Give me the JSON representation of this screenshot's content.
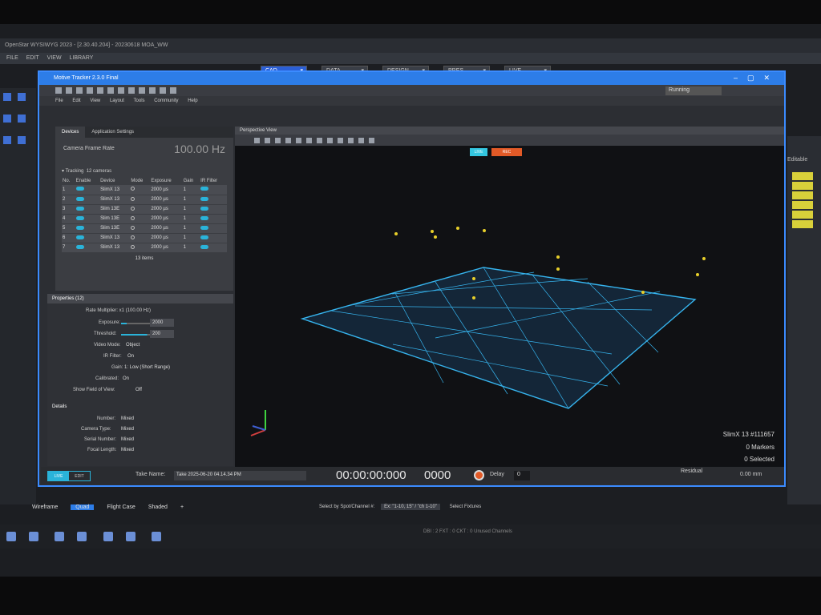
{
  "outer_app": {
    "title": "OpenStar WYSIWYG 2023 - [2.30.40.204] - 20230618 MOA_WW",
    "menu": [
      "FILE",
      "EDIT",
      "VIEW",
      "LIBRARY"
    ],
    "mode_tabs": [
      "CAD",
      "DATA",
      "DESIGN",
      "PRES",
      "LIVE"
    ],
    "active_mode": "CAD",
    "editable_label": "Editable",
    "lower_tabs": [
      "Wireframe",
      "Quad",
      "Flight Case",
      "Shaded",
      "+"
    ],
    "select_by": "Select by Spot/Channel #:",
    "select_by_value": "Ex: \"1-10, 15\" / \"ch 1-10\"",
    "select_fixtures": "Select Fixtures",
    "status": "DBI : 2   FXT : 0   CKT : 0     Unused Channels"
  },
  "motive": {
    "window_title": "Motive Tracker 2.3.0 Final",
    "menu": [
      "File",
      "Edit",
      "View",
      "Layout",
      "Tools",
      "Community",
      "Help"
    ],
    "status_select": "Running",
    "devices_panel": {
      "tabs": [
        "Devices",
        "Application Settings"
      ],
      "active_tab": "Devices",
      "frame_rate_label": "Camera Frame Rate",
      "frame_rate_value": "100.00 Hz",
      "tracking_label": "Tracking",
      "tracking_count": "12 cameras",
      "columns": [
        "No.",
        "Enable",
        "Device",
        "Mode",
        "Exposure",
        "Gain",
        "IR Filter"
      ],
      "rows": [
        {
          "no": "1",
          "device": "SlimX 13",
          "exposure": "2000 µs",
          "gain": "1"
        },
        {
          "no": "2",
          "device": "SlimX 13",
          "exposure": "2000 µs",
          "gain": "1"
        },
        {
          "no": "3",
          "device": "Slim 13E",
          "exposure": "2000 µs",
          "gain": "1"
        },
        {
          "no": "4",
          "device": "Slim 13E",
          "exposure": "2000 µs",
          "gain": "1"
        },
        {
          "no": "5",
          "device": "Slim 13E",
          "exposure": "2000 µs",
          "gain": "1"
        },
        {
          "no": "6",
          "device": "SlimX 13",
          "exposure": "2000 µs",
          "gain": "1"
        },
        {
          "no": "7",
          "device": "SlimX 13",
          "exposure": "2000 µs",
          "gain": "1"
        }
      ],
      "items_count": "13 items"
    },
    "properties_panel": {
      "title": "Properties (12)",
      "rate_multiplier": "Rate Multiplier: x1 (100.00 Hz)",
      "exposure_label": "Exposure:",
      "exposure_value": "2000",
      "exposure_level": 0.2,
      "threshold_label": "Threshold:",
      "threshold_value": "200",
      "threshold_level": 0.9,
      "video_mode_label": "Video Mode:",
      "video_mode_value": "Object",
      "ir_filter_label": "IR Filter:",
      "ir_filter_value": "On",
      "gain_label": "Gain:",
      "gain_value": "1: Low (Short Range)",
      "calibrated_label": "Calibrated:",
      "calibrated_value": "On",
      "fov_label": "Show Field of View:",
      "fov_value": "Off",
      "details_label": "Details",
      "number_label": "Number:",
      "number_value": "Mixed",
      "camera_type_label": "Camera Type:",
      "camera_type_value": "Mixed",
      "serial_label": "Serial Number:",
      "serial_value": "Mixed",
      "focal_label": "Focal Length:",
      "focal_value": "Mixed"
    },
    "viewport": {
      "title": "Perspective View",
      "live_btn": "LIVE",
      "rec_btn": "REC",
      "camera_name": "SlimX 13 #111657",
      "markers": "0 Markers",
      "selected": "0 Selected"
    },
    "bottom_bar": {
      "live": "LIVE",
      "edit": "EDIT",
      "take_label": "Take Name:",
      "take_value": "Take 2025-06-20 04.14.34 PM",
      "timecode": "00:00:00:000",
      "frame": "0000",
      "delay_label": "Delay",
      "delay_value": "0",
      "residual_label": "Residual",
      "residual_value": "0.00 mm"
    }
  }
}
